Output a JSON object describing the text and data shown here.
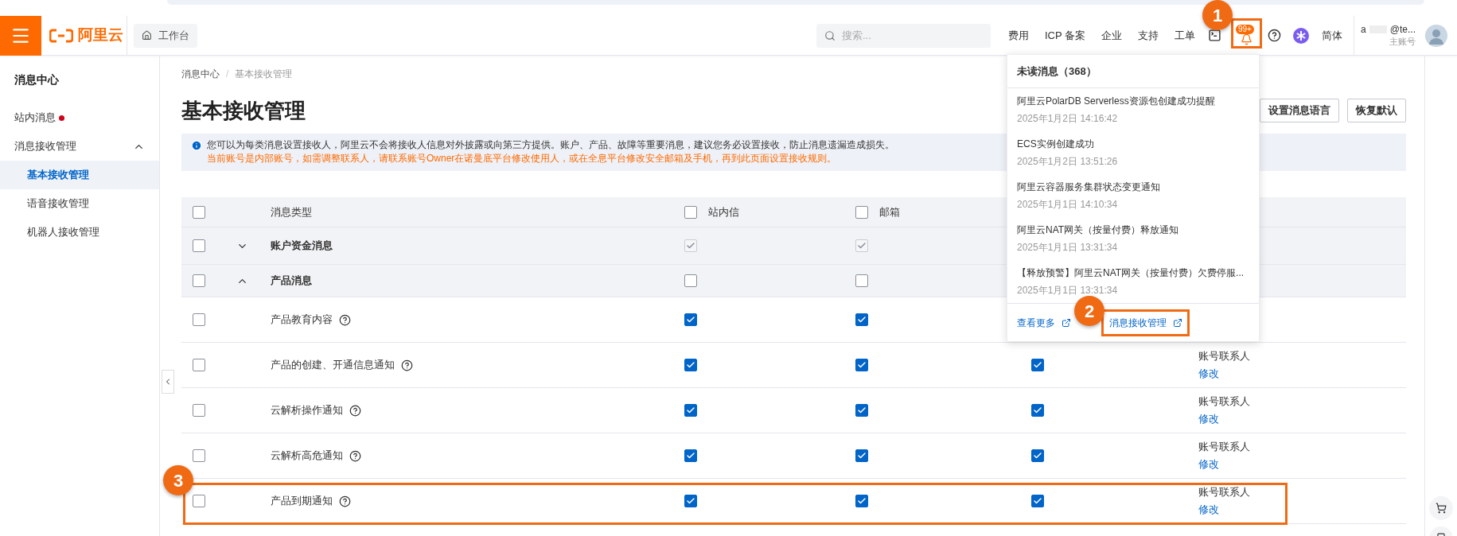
{
  "nav": {
    "brand": "阿里云",
    "workbench": "工作台",
    "search_placeholder": "搜索...",
    "links": [
      "费用",
      "ICP 备案",
      "企业",
      "支持",
      "工单"
    ],
    "notification_badge": "99+",
    "language": "简体",
    "account_name": "a",
    "account_name_end": "@te...",
    "account_role": "主账号"
  },
  "sidebar": {
    "title": "消息中心",
    "items": [
      {
        "label": "站内消息",
        "unread": true,
        "selected": false
      },
      {
        "label": "消息接收管理",
        "unread": false,
        "selected": false,
        "expanded": true,
        "children": [
          {
            "label": "基本接收管理",
            "selected": true
          },
          {
            "label": "语音接收管理",
            "selected": false
          },
          {
            "label": "机器人接收管理",
            "selected": false
          }
        ]
      }
    ]
  },
  "main": {
    "breadcrumb": [
      "消息中心",
      "基本接收管理"
    ],
    "breadcrumb_separator": "/",
    "title": "基本接收管理",
    "buttons": [
      "设置消息语言",
      "恢复默认"
    ],
    "notice": {
      "text": "您可以为每类消息设置接收人，阿里云不会将接收人信息对外披露或向第三方提供。账户、产品、故障等重要消息，建议您务必设置接收，防止消息遗漏造成损失。",
      "warning": "当前账号是内部账号，如需调整联系人，请联系账号Owner在诺曼底平台修改使用人，或在全息平台修改安全邮箱及手机，再到此页面设置接收规则。"
    },
    "table": {
      "header": {
        "checked": false,
        "type": "消息类型",
        "inbox": {
          "label": "站内信",
          "checked": false
        },
        "email": {
          "label": "邮箱",
          "checked": false
        }
      },
      "rows": [
        {
          "kind": "group",
          "label": "账户资金消息",
          "expanded": false,
          "checked": false,
          "inbox": true,
          "email": true,
          "locked": true
        },
        {
          "kind": "group",
          "label": "产品消息",
          "expanded": true,
          "checked": false,
          "inbox": false,
          "email": false,
          "locked": false
        },
        {
          "kind": "item",
          "label": "产品教育内容",
          "checked": false,
          "inbox": true,
          "email": true
        },
        {
          "kind": "item",
          "label": "产品的创建、开通信息通知",
          "checked": false,
          "inbox": true,
          "email": true,
          "column_3": true,
          "contact": "账号联系人",
          "action": "修改"
        },
        {
          "kind": "item",
          "label": "云解析操作通知",
          "checked": false,
          "inbox": true,
          "email": true,
          "column_3": true,
          "contact": "账号联系人",
          "action": "修改"
        },
        {
          "kind": "item",
          "label": "云解析高危通知",
          "checked": false,
          "inbox": true,
          "email": true,
          "column_3": true,
          "contact": "账号联系人",
          "action": "修改"
        },
        {
          "kind": "item",
          "label": "产品到期通知",
          "checked": false,
          "inbox": true,
          "email": true,
          "column_3": true,
          "contact": "账号联系人",
          "action": "修改"
        }
      ]
    }
  },
  "dropdown": {
    "title": "未读消息（368）",
    "items": [
      {
        "title": "阿里云PolarDB Serverless资源包创建成功提醒",
        "time": "2025年1月2日 14:16:42"
      },
      {
        "title": "ECS实例创建成功",
        "time": "2025年1月2日 13:51:26"
      },
      {
        "title": "阿里云容器服务集群状态变更通知",
        "time": "2025年1月1日 14:10:34"
      },
      {
        "title": "阿里云NAT网关（按量付费）释放通知",
        "time": "2025年1月1日 13:31:34"
      },
      {
        "title": "【释放预警】阿里云NAT网关（按量付费）欠费停服...",
        "time": "2025年1月1日 13:31:34"
      }
    ],
    "links": [
      "查看更多",
      "消息接收管理"
    ]
  },
  "annotations": [
    {
      "label": "1"
    },
    {
      "label": "2"
    },
    {
      "label": "3"
    }
  ]
}
